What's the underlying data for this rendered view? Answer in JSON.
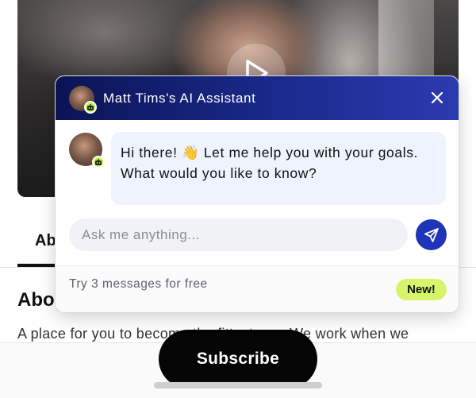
{
  "page": {
    "tab_label": "Ab",
    "about_heading": "Abo",
    "about_text": "A place for you to become the fittest you. We work when we"
  },
  "chat": {
    "title": "Matt Tims's AI Assistant",
    "message": "Hi there! 👋 Let me help you with your goals. What would you like to know?",
    "input_placeholder": "Ask me anything...",
    "footer_text": "Try 3 messages for free",
    "badge": "New!",
    "icons": {
      "close": "close-icon",
      "send": "send-icon",
      "bot": "bot-icon",
      "play": "play-icon"
    }
  },
  "subscribe": {
    "label": "Subscribe"
  },
  "colors": {
    "header_start": "#0a1454",
    "header_end": "#2c3ab0",
    "send_button": "#1f35b8",
    "badge": "#d6f56b",
    "bubble": "#eef3fd",
    "subscribe": "#050505"
  }
}
